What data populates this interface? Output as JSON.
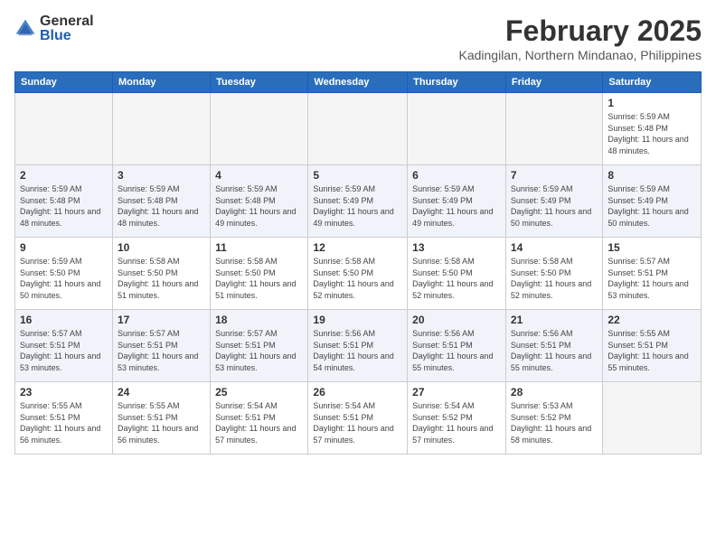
{
  "logo": {
    "general": "General",
    "blue": "Blue"
  },
  "header": {
    "month": "February 2025",
    "location": "Kadingilan, Northern Mindanao, Philippines"
  },
  "weekdays": [
    "Sunday",
    "Monday",
    "Tuesday",
    "Wednesday",
    "Thursday",
    "Friday",
    "Saturday"
  ],
  "weeks": [
    [
      {
        "day": "",
        "empty": true
      },
      {
        "day": "",
        "empty": true
      },
      {
        "day": "",
        "empty": true
      },
      {
        "day": "",
        "empty": true
      },
      {
        "day": "",
        "empty": true
      },
      {
        "day": "",
        "empty": true
      },
      {
        "day": "1",
        "sunrise": "Sunrise: 5:59 AM",
        "sunset": "Sunset: 5:48 PM",
        "daylight": "Daylight: 11 hours and 48 minutes."
      }
    ],
    [
      {
        "day": "2",
        "sunrise": "Sunrise: 5:59 AM",
        "sunset": "Sunset: 5:48 PM",
        "daylight": "Daylight: 11 hours and 48 minutes."
      },
      {
        "day": "3",
        "sunrise": "Sunrise: 5:59 AM",
        "sunset": "Sunset: 5:48 PM",
        "daylight": "Daylight: 11 hours and 48 minutes."
      },
      {
        "day": "4",
        "sunrise": "Sunrise: 5:59 AM",
        "sunset": "Sunset: 5:48 PM",
        "daylight": "Daylight: 11 hours and 49 minutes."
      },
      {
        "day": "5",
        "sunrise": "Sunrise: 5:59 AM",
        "sunset": "Sunset: 5:49 PM",
        "daylight": "Daylight: 11 hours and 49 minutes."
      },
      {
        "day": "6",
        "sunrise": "Sunrise: 5:59 AM",
        "sunset": "Sunset: 5:49 PM",
        "daylight": "Daylight: 11 hours and 49 minutes."
      },
      {
        "day": "7",
        "sunrise": "Sunrise: 5:59 AM",
        "sunset": "Sunset: 5:49 PM",
        "daylight": "Daylight: 11 hours and 50 minutes."
      },
      {
        "day": "8",
        "sunrise": "Sunrise: 5:59 AM",
        "sunset": "Sunset: 5:49 PM",
        "daylight": "Daylight: 11 hours and 50 minutes."
      }
    ],
    [
      {
        "day": "9",
        "sunrise": "Sunrise: 5:59 AM",
        "sunset": "Sunset: 5:50 PM",
        "daylight": "Daylight: 11 hours and 50 minutes."
      },
      {
        "day": "10",
        "sunrise": "Sunrise: 5:58 AM",
        "sunset": "Sunset: 5:50 PM",
        "daylight": "Daylight: 11 hours and 51 minutes."
      },
      {
        "day": "11",
        "sunrise": "Sunrise: 5:58 AM",
        "sunset": "Sunset: 5:50 PM",
        "daylight": "Daylight: 11 hours and 51 minutes."
      },
      {
        "day": "12",
        "sunrise": "Sunrise: 5:58 AM",
        "sunset": "Sunset: 5:50 PM",
        "daylight": "Daylight: 11 hours and 52 minutes."
      },
      {
        "day": "13",
        "sunrise": "Sunrise: 5:58 AM",
        "sunset": "Sunset: 5:50 PM",
        "daylight": "Daylight: 11 hours and 52 minutes."
      },
      {
        "day": "14",
        "sunrise": "Sunrise: 5:58 AM",
        "sunset": "Sunset: 5:50 PM",
        "daylight": "Daylight: 11 hours and 52 minutes."
      },
      {
        "day": "15",
        "sunrise": "Sunrise: 5:57 AM",
        "sunset": "Sunset: 5:51 PM",
        "daylight": "Daylight: 11 hours and 53 minutes."
      }
    ],
    [
      {
        "day": "16",
        "sunrise": "Sunrise: 5:57 AM",
        "sunset": "Sunset: 5:51 PM",
        "daylight": "Daylight: 11 hours and 53 minutes."
      },
      {
        "day": "17",
        "sunrise": "Sunrise: 5:57 AM",
        "sunset": "Sunset: 5:51 PM",
        "daylight": "Daylight: 11 hours and 53 minutes."
      },
      {
        "day": "18",
        "sunrise": "Sunrise: 5:57 AM",
        "sunset": "Sunset: 5:51 PM",
        "daylight": "Daylight: 11 hours and 53 minutes."
      },
      {
        "day": "19",
        "sunrise": "Sunrise: 5:56 AM",
        "sunset": "Sunset: 5:51 PM",
        "daylight": "Daylight: 11 hours and 54 minutes."
      },
      {
        "day": "20",
        "sunrise": "Sunrise: 5:56 AM",
        "sunset": "Sunset: 5:51 PM",
        "daylight": "Daylight: 11 hours and 55 minutes."
      },
      {
        "day": "21",
        "sunrise": "Sunrise: 5:56 AM",
        "sunset": "Sunset: 5:51 PM",
        "daylight": "Daylight: 11 hours and 55 minutes."
      },
      {
        "day": "22",
        "sunrise": "Sunrise: 5:55 AM",
        "sunset": "Sunset: 5:51 PM",
        "daylight": "Daylight: 11 hours and 55 minutes."
      }
    ],
    [
      {
        "day": "23",
        "sunrise": "Sunrise: 5:55 AM",
        "sunset": "Sunset: 5:51 PM",
        "daylight": "Daylight: 11 hours and 56 minutes."
      },
      {
        "day": "24",
        "sunrise": "Sunrise: 5:55 AM",
        "sunset": "Sunset: 5:51 PM",
        "daylight": "Daylight: 11 hours and 56 minutes."
      },
      {
        "day": "25",
        "sunrise": "Sunrise: 5:54 AM",
        "sunset": "Sunset: 5:51 PM",
        "daylight": "Daylight: 11 hours and 57 minutes."
      },
      {
        "day": "26",
        "sunrise": "Sunrise: 5:54 AM",
        "sunset": "Sunset: 5:51 PM",
        "daylight": "Daylight: 11 hours and 57 minutes."
      },
      {
        "day": "27",
        "sunrise": "Sunrise: 5:54 AM",
        "sunset": "Sunset: 5:52 PM",
        "daylight": "Daylight: 11 hours and 57 minutes."
      },
      {
        "day": "28",
        "sunrise": "Sunrise: 5:53 AM",
        "sunset": "Sunset: 5:52 PM",
        "daylight": "Daylight: 11 hours and 58 minutes."
      },
      {
        "day": "",
        "empty": true
      }
    ]
  ]
}
